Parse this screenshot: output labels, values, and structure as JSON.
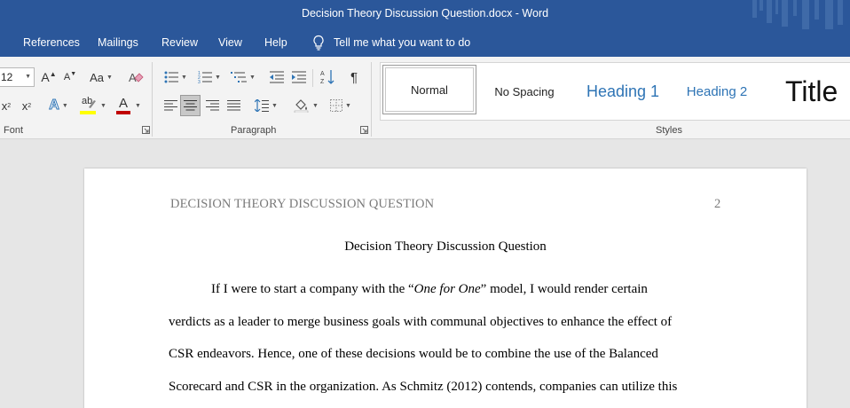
{
  "window": {
    "title": "Decision Theory Discussion Question.docx  -  Word"
  },
  "tabs": [
    {
      "label": "References"
    },
    {
      "label": "Mailings"
    },
    {
      "label": "Review"
    },
    {
      "label": "View"
    },
    {
      "label": "Help"
    }
  ],
  "tell_me": {
    "text": "Tell me what you want to do",
    "icon": "lightbulb-icon"
  },
  "ribbon": {
    "font": {
      "label": "Font",
      "size_value": "12",
      "grow_label": "A",
      "shrink_label": "A",
      "case_label": "Aa",
      "sub_label": "x",
      "sub_mark": "2",
      "sup_label": "x",
      "sup_mark": "2",
      "effects_label": "A",
      "highlight_label": "ab",
      "color_label": "A",
      "highlight_color": "#ffff00",
      "font_color": "#c00000"
    },
    "paragraph": {
      "label": "Paragraph",
      "pilcrow": "¶"
    },
    "styles": {
      "label": "Styles",
      "items": [
        {
          "label": "Normal"
        },
        {
          "label": "No Spacing"
        },
        {
          "label": "Heading 1"
        },
        {
          "label": "Heading 2"
        },
        {
          "label": "Title"
        }
      ]
    }
  },
  "document": {
    "header_left": "DECISION THEORY DISCUSSION QUESTION",
    "header_right": "2",
    "title": "Decision Theory Discussion Question",
    "lines": {
      "l1_before": "If I were to start a company with the “",
      "l1_italic": "One for One",
      "l1_after": "” model, I would render certain",
      "l2": "verdicts as a leader to merge business goals with communal objectives to enhance the effect of",
      "l3": "CSR endeavors. Hence, one of these decisions would be to combine the use of the Balanced",
      "l4": "Scorecard and CSR in the organization. As Schmitz (2012) contends, companies can utilize this"
    }
  },
  "colors": {
    "title_bar": "#2b579a",
    "ribbon_bg": "#f3f3f3",
    "heading_blue": "#2e74b5",
    "doc_bg": "#e6e6e6"
  }
}
